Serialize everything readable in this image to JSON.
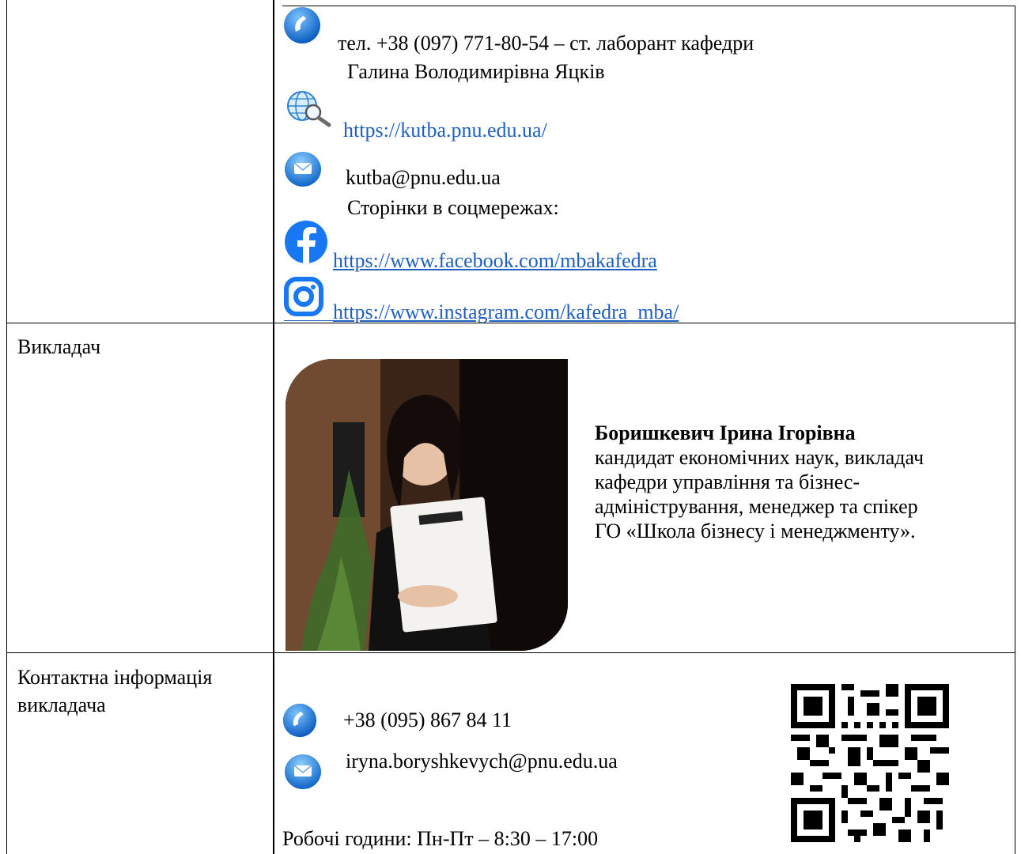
{
  "department_contacts": {
    "phone_line": "тел. +38 (097) 771-80-54 –  ст. лаборант кафедри",
    "phone_person": "Галина Володимирівна Яцків",
    "website": "https://kutba.pnu.edu.ua/",
    "email": "kutba@pnu.edu.ua",
    "social_label": "Сторінки в соцмережах:",
    "facebook_url": "https://www.facebook.com/mbakafedra",
    "instagram_url": "https://www.instagram.com/kafedra_mba/"
  },
  "teacher_row": {
    "label": "Викладач",
    "name": "Боришкевич Ірина Ігорівна",
    "bio_lines": [
      "кандидат економічних наук, викладач",
      "кафедри управління та бізнес-",
      "адміністрування, менеджер та спікер",
      "ГО «Школа бізнесу і менеджменту»."
    ]
  },
  "contact_row": {
    "label_line1": "Контактна інформація",
    "label_line2": "викладача",
    "phone": "+38 (095) 867 84 11",
    "email": "iryna.boryshkevych@pnu.edu.ua",
    "hours": "Робочі години: Пн-Пт – 8:30 – 17:00"
  },
  "icons": {
    "phone": "phone-icon",
    "web": "globe-search-icon",
    "mail": "mail-icon",
    "facebook": "facebook-icon",
    "instagram": "instagram-icon",
    "qr": "qr-code-icon"
  },
  "colors": {
    "link": "#1f5fbf",
    "icon_blue": "#1e7fd6",
    "facebook": "#1877f2",
    "instagram": "#1877f2"
  }
}
